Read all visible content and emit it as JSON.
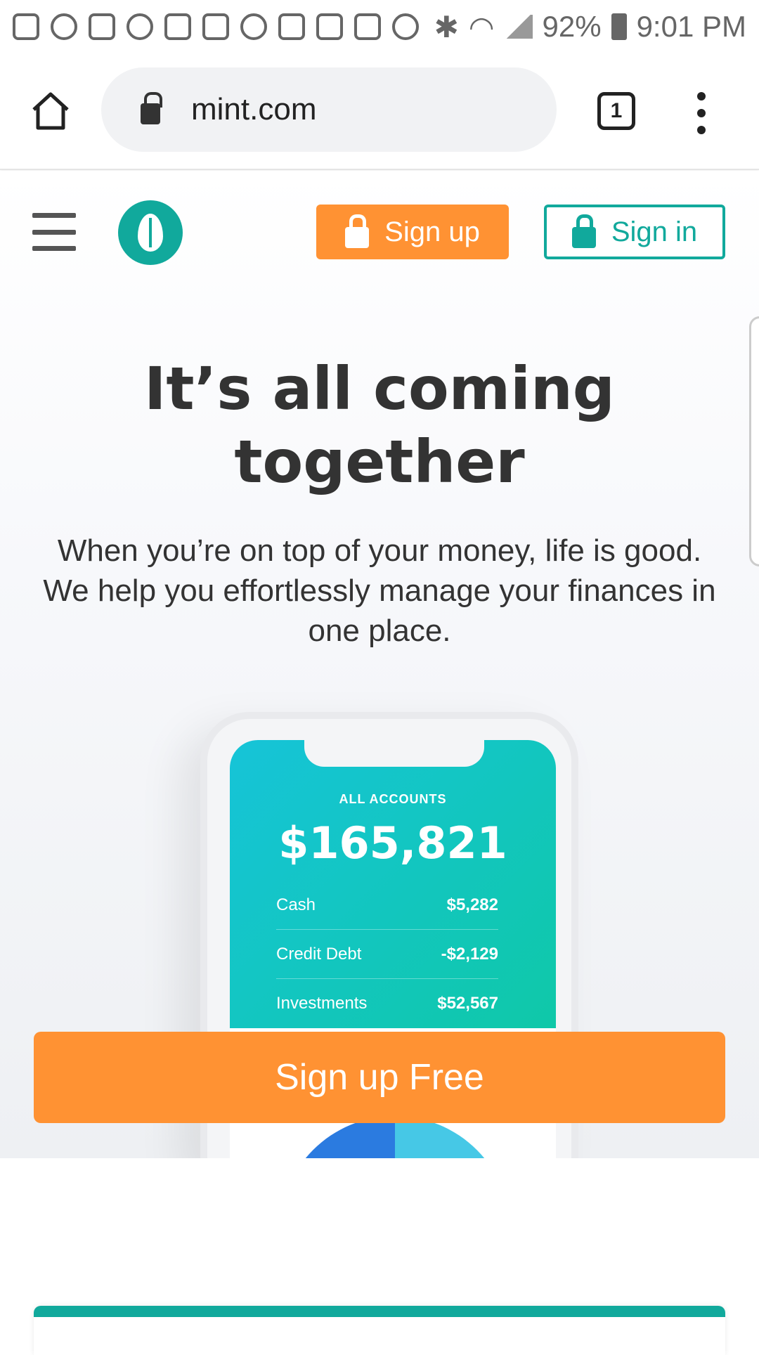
{
  "status_bar": {
    "battery": "92%",
    "time": "9:01 PM",
    "icons": [
      "voicemail-icon",
      "notification-icon",
      "message-icon",
      "voicemail-icon",
      "gmail-icon",
      "image-icon",
      "loading-icon",
      "game-icon",
      "pen-icon",
      "battery-saver-icon",
      "add-icon",
      "bluetooth-icon",
      "wifi-icon",
      "signal-icon",
      "battery-icon"
    ]
  },
  "browser": {
    "url": "mint.com",
    "tab_count": "1"
  },
  "header": {
    "signup_label": "Sign up",
    "signin_label": "Sign in"
  },
  "hero": {
    "title": "It’s all coming together",
    "subtitle": "When you’re on top of your money, life is good. We help you effortlessly manage your finances in one place."
  },
  "phone_mockup": {
    "label": "ALL ACCOUNTS",
    "total": "$165,821",
    "rows": [
      {
        "name": "Cash",
        "value": "$5,282"
      },
      {
        "name": "Credit Debt",
        "value": "-$2,129"
      },
      {
        "name": "Investments",
        "value": "$52,567"
      }
    ]
  },
  "cta": {
    "label": "Sign up Free"
  },
  "colors": {
    "brand": "#11a99c",
    "accent": "#ff9233"
  }
}
